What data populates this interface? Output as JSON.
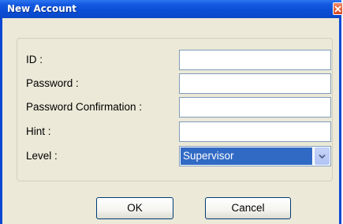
{
  "window": {
    "title": "New Account"
  },
  "form": {
    "id_label": "ID :",
    "id_value": "",
    "password_label": "Password :",
    "password_value": "",
    "password_confirmation_label": "Password Confirmation :",
    "password_confirmation_value": "",
    "hint_label": "Hint :",
    "hint_value": "",
    "level_label": "Level :",
    "level_value": "Supervisor"
  },
  "buttons": {
    "ok_label": "OK",
    "cancel_label": "Cancel"
  },
  "icons": {
    "close": "close-icon",
    "dropdown": "chevron-down-icon"
  },
  "colors": {
    "title_bar": "#0b4ed6",
    "selection": "#316ac5",
    "close_button": "#d8461f",
    "dialog_background": "#ece9d8"
  }
}
